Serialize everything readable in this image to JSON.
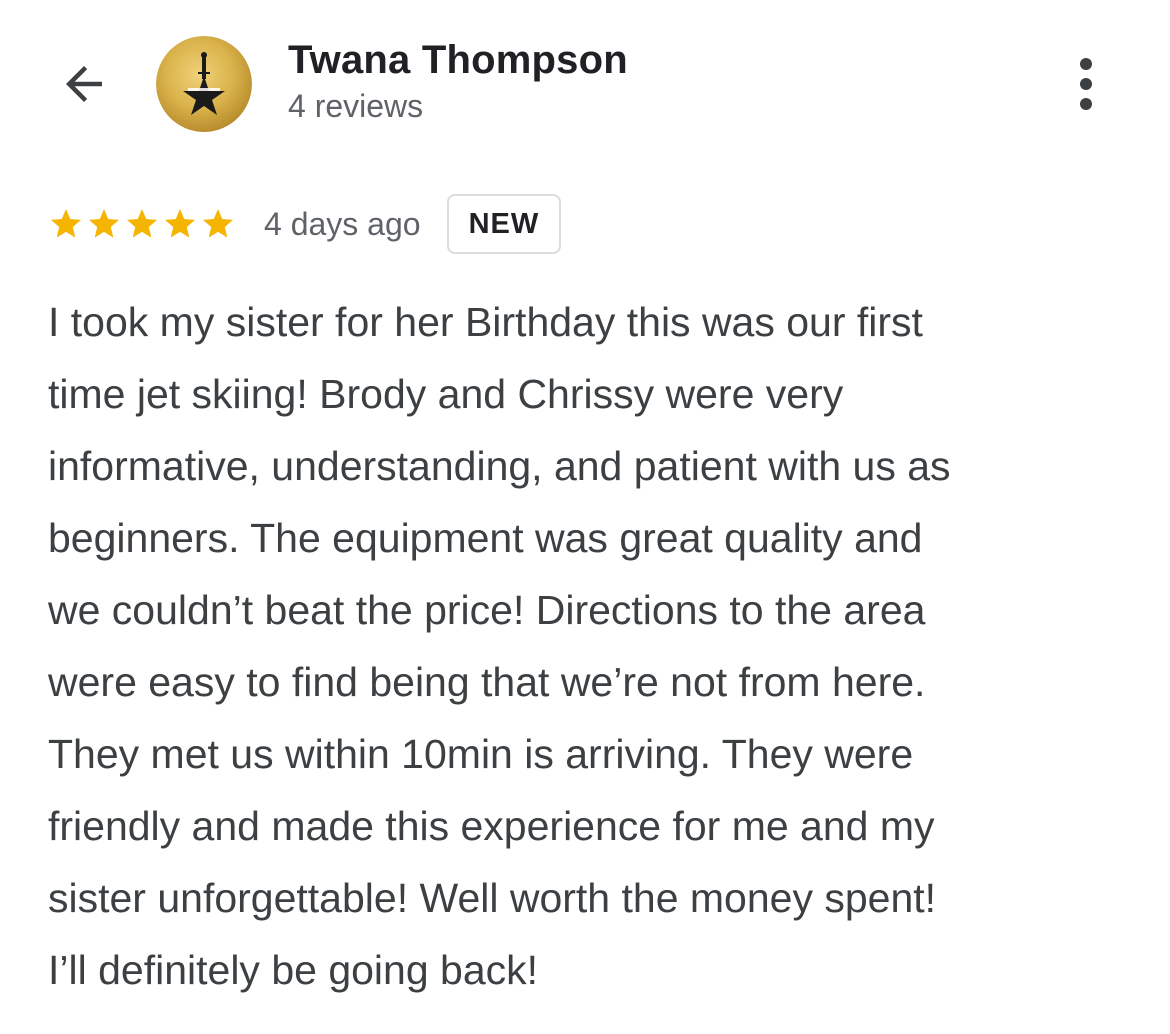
{
  "header": {
    "back_icon": "arrow-left-icon",
    "avatar_icon": "hamilton-star-avatar",
    "reviewer_name": "Twana Thompson",
    "reviewer_meta": "4 reviews",
    "more_icon": "more-vertical-icon"
  },
  "review": {
    "rating": 5,
    "rating_max": 5,
    "star_color": "#f4b400",
    "time": "4 days ago",
    "badge": "NEW",
    "text_lines": [
      "I took my sister for her Birthday this was our first",
      "time jet skiing! Brody and Chrissy were very",
      "informative, understanding, and patient with us as",
      "beginners. The equipment was great quality and",
      "we couldn’t beat the price! Directions to the area",
      "were easy to find being that we’re not from here.",
      "They met us within 10min is arriving. They were",
      "friendly and made this experience for me and my",
      "sister unforgettable! Well worth the money spent!",
      "I’ll definitely be going back!"
    ]
  }
}
